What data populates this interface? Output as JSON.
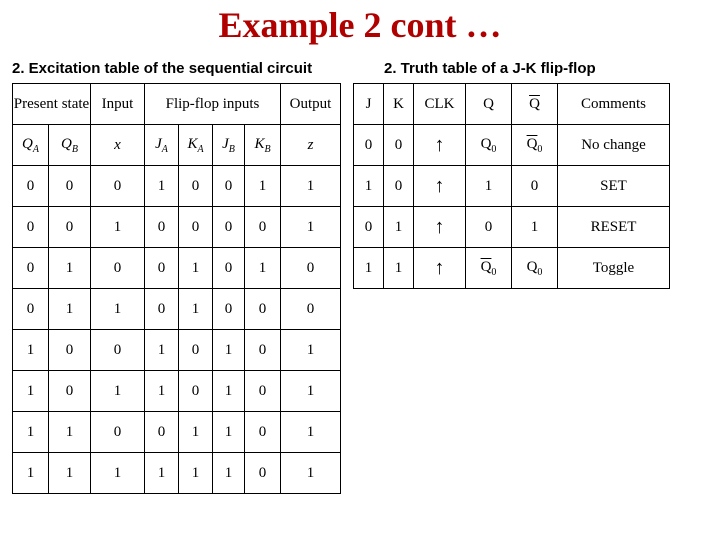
{
  "title": "Example 2 cont …",
  "caption_left": "2. Excitation table of the sequential circuit",
  "caption_right": "2. Truth table of a J-K flip-flop",
  "excitation": {
    "group_headers": {
      "present_state": "Present state",
      "input": "Input",
      "flipflop_inputs": "Flip-flop inputs",
      "output": "Output"
    },
    "col_headers": {
      "QA": "Q",
      "QA_sub": "A",
      "QB": "Q",
      "QB_sub": "B",
      "x": "x",
      "JA": "J",
      "JA_sub": "A",
      "KA": "K",
      "KA_sub": "A",
      "JB": "J",
      "JB_sub": "B",
      "KB": "K",
      "KB_sub": "B",
      "z": "z"
    },
    "rows": [
      [
        "0",
        "0",
        "0",
        "1",
        "0",
        "0",
        "1",
        "1"
      ],
      [
        "0",
        "0",
        "1",
        "0",
        "0",
        "0",
        "0",
        "1"
      ],
      [
        "0",
        "1",
        "0",
        "0",
        "1",
        "0",
        "1",
        "0"
      ],
      [
        "0",
        "1",
        "1",
        "0",
        "1",
        "0",
        "0",
        "0"
      ],
      [
        "1",
        "0",
        "0",
        "1",
        "0",
        "1",
        "0",
        "1"
      ],
      [
        "1",
        "0",
        "1",
        "1",
        "0",
        "1",
        "0",
        "1"
      ],
      [
        "1",
        "1",
        "0",
        "0",
        "1",
        "1",
        "0",
        "1"
      ],
      [
        "1",
        "1",
        "1",
        "1",
        "1",
        "1",
        "0",
        "1"
      ]
    ]
  },
  "truth": {
    "headers": {
      "J": "J",
      "K": "K",
      "CLK": "CLK",
      "Q": "Q",
      "Qbar": "Q",
      "Comments": "Comments"
    },
    "arrow": "↑",
    "rows": [
      {
        "J": "0",
        "K": "0",
        "Q": "Q",
        "Q_sub": "0",
        "Qbar": "Q",
        "Qbar_sub": "0",
        "Qbar_over": true,
        "comment": "No change"
      },
      {
        "J": "1",
        "K": "0",
        "Q": "1",
        "Qbar": "0",
        "comment": "SET"
      },
      {
        "J": "0",
        "K": "1",
        "Q": "0",
        "Qbar": "1",
        "comment": "RESET"
      },
      {
        "J": "1",
        "K": "1",
        "Q": "Q",
        "Q_sub": "0",
        "Q_over": true,
        "Qbar": "Q",
        "Qbar_sub": "0",
        "comment": "Toggle"
      }
    ]
  }
}
